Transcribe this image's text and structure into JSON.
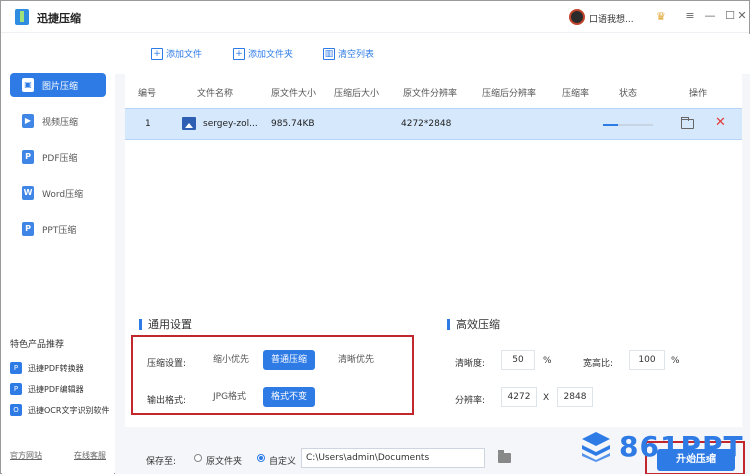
{
  "app": {
    "title": "迅捷压缩",
    "user_name": "口语我想..."
  },
  "colors": {
    "accent": "#2e7be6",
    "danger": "#e23a3a",
    "highlight": "#c2272d"
  },
  "sidebar": {
    "items": [
      {
        "label": "图片压缩",
        "icon": "image-icon",
        "active": true
      },
      {
        "label": "视频压缩",
        "icon": "video-icon"
      },
      {
        "label": "PDF压缩",
        "icon": "pdf-icon"
      },
      {
        "label": "Word压缩",
        "icon": "word-icon"
      },
      {
        "label": "PPT压缩",
        "icon": "ppt-icon"
      }
    ],
    "promo_title": "特色产品推荐",
    "promo_items": [
      "迅捷PDF转换器",
      "迅捷PDF编辑器",
      "迅捷OCR文字识别软件"
    ],
    "links": {
      "official": "官方网站",
      "support": "在线客服"
    }
  },
  "toolbar": {
    "add_file": "添加文件",
    "add_folder": "添加文件夹",
    "clear_list": "清空列表"
  },
  "table": {
    "headers": [
      "编号",
      "文件名称",
      "原文件大小",
      "压缩后大小",
      "原文件分辨率",
      "压缩后分辨率",
      "压缩率",
      "状态",
      "操作"
    ],
    "rows": [
      {
        "index": "1",
        "name": "sergey-zol...",
        "orig_size": "985.74KB",
        "comp_size": "",
        "orig_res": "4272*2848",
        "comp_res": "",
        "ratio": "",
        "progress": 0.3
      }
    ]
  },
  "settings": {
    "general_title": "通用设置",
    "compress_label": "压缩设置:",
    "compress_options": [
      "缩小优先",
      "普通压缩",
      "清晰优先"
    ],
    "compress_selected": "普通压缩",
    "format_label": "输出格式:",
    "format_options": [
      "JPG格式",
      "格式不变"
    ],
    "format_selected": "格式不变",
    "efficient_title": "高效压缩",
    "clarity_label": "清晰度:",
    "clarity_value": "50",
    "clarity_unit": "%",
    "aspect_label": "宽高比:",
    "aspect_value": "100",
    "aspect_unit": "%",
    "resolution_label": "分辨率:",
    "res_width": "4272",
    "res_sep": "X",
    "res_height": "2848"
  },
  "footer": {
    "save_label": "保存至:",
    "option_original": "原文件夹",
    "option_custom": "自定义",
    "path": "C:\\Users\\admin\\Documents",
    "start_button": "开始压缩"
  },
  "watermark": "861PPT"
}
